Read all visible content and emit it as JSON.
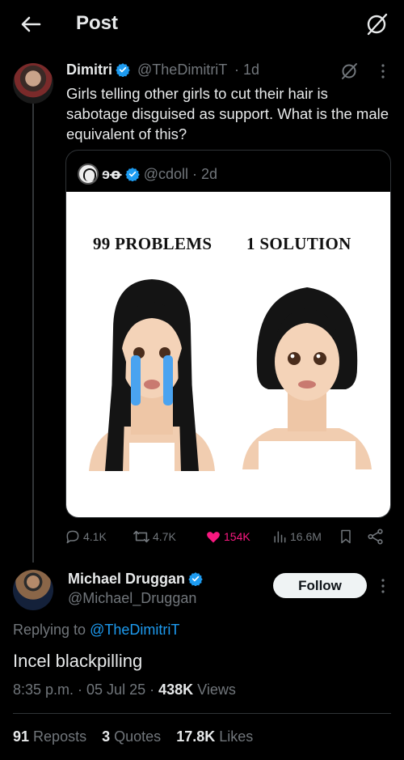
{
  "header": {
    "title": "Post"
  },
  "post": {
    "author_name": "Dimitri",
    "author_handle": "@TheDimitriT",
    "time": "· 1d",
    "text": "Girls telling other girls to cut their hair is sabotage disguised as support. What is the male equivalent of this?",
    "quote": {
      "author_name": "ɘꝋ",
      "author_handle": "@cdoll",
      "time": "· 2d",
      "image_labels": {
        "left": "99 PROBLEMS",
        "right": "1 SOLUTION"
      }
    },
    "actions": {
      "replies": "4.1K",
      "reposts": "4.7K",
      "likes": "154K",
      "views": "16.6M"
    }
  },
  "reply": {
    "author_name": "Michael Druggan",
    "author_handle": "@Michael_Druggan",
    "follow_label": "Follow",
    "replying_prefix": "Replying to",
    "replying_to": "@TheDimitriT",
    "text": "Incel blackpilling",
    "timestamp": "8:35 p.m. · 05 Jul 25 ·",
    "views_count": "438K",
    "views_label": "Views",
    "stats": {
      "reposts_count": "91",
      "reposts_label": "Reposts",
      "quotes_count": "3",
      "quotes_label": "Quotes",
      "likes_count": "17.8K",
      "likes_label": "Likes"
    }
  },
  "colors": {
    "background": "#000000",
    "text": "#e7e9ea",
    "muted": "#71767b",
    "accent": "#1d9bf0",
    "like": "#f91880"
  },
  "icons": [
    "back-arrow-icon",
    "grok-icon",
    "more-icon",
    "verified-icon",
    "reply-icon",
    "repost-icon",
    "heart-icon",
    "views-icon",
    "bookmark-icon",
    "share-icon"
  ]
}
